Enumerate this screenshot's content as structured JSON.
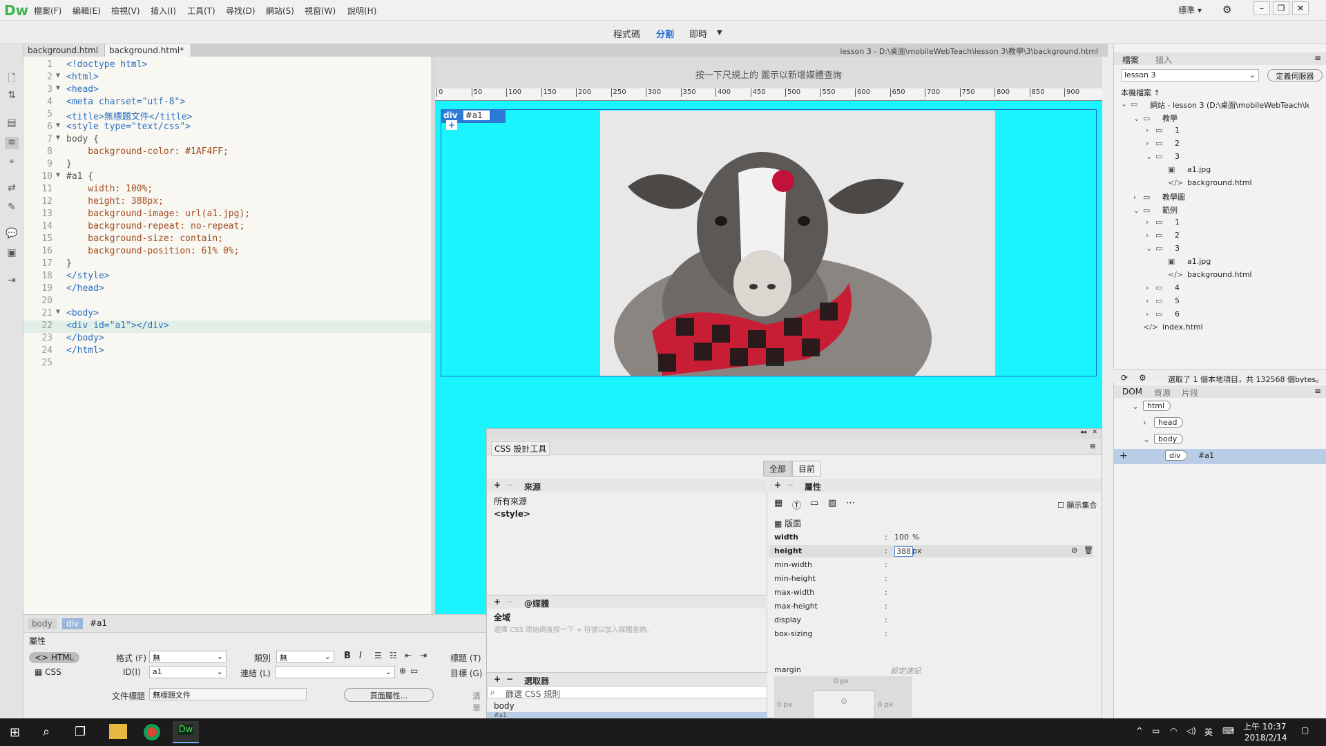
{
  "app": {
    "logo": "Dw"
  },
  "menu": [
    "檔案(F)",
    "編輯(E)",
    "檢視(V)",
    "插入(I)",
    "工具(T)",
    "尋找(D)",
    "網站(S)",
    "視窗(W)",
    "說明(H)"
  ],
  "layout_label": "標準",
  "view_buttons": {
    "code": "程式碼",
    "split": "分割",
    "live": "即時"
  },
  "tabs": [
    "background.html",
    "background.html*"
  ],
  "doc_path": "lesson 3 - D:\\桌面\\mobileWebTeach\\lesson 3\\教學\\3\\background.html",
  "code_lines": [
    {
      "n": "1",
      "text": "<!doctype html>"
    },
    {
      "n": "2",
      "text": "<html>"
    },
    {
      "n": "3",
      "text": "<head>"
    },
    {
      "n": "4",
      "text": "<meta charset=\"utf-8\">"
    },
    {
      "n": "5",
      "text": "<title>無標題文件</title>"
    },
    {
      "n": "6",
      "text": "<style type=\"text/css\">"
    },
    {
      "n": "7",
      "text": "body {"
    },
    {
      "n": "8",
      "text": "    background-color: #1AF4FF;"
    },
    {
      "n": "9",
      "text": "}"
    },
    {
      "n": "10",
      "text": "#a1 {"
    },
    {
      "n": "11",
      "text": "    width: 100%;"
    },
    {
      "n": "12",
      "text": "    height: 388px;"
    },
    {
      "n": "13",
      "text": "    background-image: url(a1.jpg);"
    },
    {
      "n": "14",
      "text": "    background-repeat: no-repeat;"
    },
    {
      "n": "15",
      "text": "    background-size: contain;"
    },
    {
      "n": "16",
      "text": "    background-position: 61% 0%;"
    },
    {
      "n": "17",
      "text": "}"
    },
    {
      "n": "18",
      "text": "</style>"
    },
    {
      "n": "19",
      "text": "</head>"
    },
    {
      "n": "20",
      "text": ""
    },
    {
      "n": "21",
      "text": "<body>"
    },
    {
      "n": "22",
      "text": "<div id=\"a1\"></div>"
    },
    {
      "n": "23",
      "text": "</body>"
    },
    {
      "n": "24",
      "text": "</html>"
    },
    {
      "n": "25",
      "text": ""
    }
  ],
  "design": {
    "mq_hint": "按一下尺規上的  圖示以新增媒體查詢",
    "ruler_ticks": [
      "0",
      "50",
      "100",
      "150",
      "200",
      "250",
      "300",
      "350",
      "400",
      "450",
      "500",
      "550",
      "600",
      "650",
      "700",
      "750",
      "800",
      "850",
      "900"
    ],
    "div_badge": "div",
    "div_id": "#a1",
    "bg_color": "#1AF4FF"
  },
  "css_designer": {
    "title": "CSS 設計工具",
    "modes": [
      "全部",
      "目前"
    ],
    "sources_label": "來源",
    "sources": [
      "所有來源",
      "<style>"
    ],
    "media_label": "@媒體",
    "media_global": "全域",
    "media_hint": "選擇 CSS 原始碼後按一下 + 符號以加入媒體查詢。",
    "selectors_label": "選取器",
    "filter_placeholder": "篩選 CSS 規則",
    "selectors": [
      "body",
      "#a1"
    ],
    "properties_label": "屬性",
    "show_set": "顯示集合",
    "layout_section": "版面",
    "props": [
      {
        "name": "width",
        "value": "100",
        "unit": "%"
      },
      {
        "name": "height",
        "value": "388",
        "unit": "px"
      },
      {
        "name": "min-width",
        "value": "",
        "unit": ""
      },
      {
        "name": "min-height",
        "value": "",
        "unit": ""
      },
      {
        "name": "max-width",
        "value": "",
        "unit": ""
      },
      {
        "name": "max-height",
        "value": "",
        "unit": ""
      },
      {
        "name": "display",
        "value": "",
        "unit": ""
      },
      {
        "name": "box-sizing",
        "value": "",
        "unit": ""
      }
    ],
    "margin_label": "margin",
    "margin_hint": "設定速記",
    "margin_values": [
      "0 px",
      "0 px",
      "0 px",
      "0 px"
    ]
  },
  "tag_selector": [
    "body",
    "div",
    "#a1"
  ],
  "properties_panel": {
    "title": "屬性",
    "html_btn": "HTML",
    "css_btn": "CSS",
    "format_label": "格式 (F)",
    "format_value": "無",
    "id_label": "ID(I)",
    "id_value": "a1",
    "class_label": "類別",
    "class_value": "無",
    "link_label": "連結 (L)",
    "title_label": "標題 (T)",
    "target_label": "目標 (G)",
    "doc_title_label": "文件標題",
    "doc_title_value": "無標題文件",
    "page_props_btn": "頁面屬性...",
    "list_items_label": "清單"
  },
  "files_panel": {
    "tabs": [
      "檔案",
      "插入"
    ],
    "site_select": "lesson 3",
    "define_btn": "定義伺服器",
    "local_files": "本機檔案 ↑",
    "tree": [
      {
        "d": 0,
        "t": "網站 - lesson 3 (D:\\桌面\\mobileWebTeach\\less...",
        "k": "folder"
      },
      {
        "d": 1,
        "t": "教學",
        "k": "folder"
      },
      {
        "d": 2,
        "t": "1",
        "k": "folder"
      },
      {
        "d": 2,
        "t": "2",
        "k": "folder"
      },
      {
        "d": 2,
        "t": "3",
        "k": "folder"
      },
      {
        "d": 3,
        "t": "a1.jpg",
        "k": "image"
      },
      {
        "d": 3,
        "t": "background.html",
        "k": "code"
      },
      {
        "d": 1,
        "t": "教學圖",
        "k": "folder"
      },
      {
        "d": 1,
        "t": "範例",
        "k": "folder"
      },
      {
        "d": 2,
        "t": "1",
        "k": "folder"
      },
      {
        "d": 2,
        "t": "2",
        "k": "folder"
      },
      {
        "d": 2,
        "t": "3",
        "k": "folder"
      },
      {
        "d": 3,
        "t": "a1.jpg",
        "k": "image"
      },
      {
        "d": 3,
        "t": "background.html",
        "k": "code"
      },
      {
        "d": 2,
        "t": "4",
        "k": "folder"
      },
      {
        "d": 2,
        "t": "5",
        "k": "folder"
      },
      {
        "d": 2,
        "t": "6",
        "k": "folder"
      },
      {
        "d": 1,
        "t": "index.html",
        "k": "code"
      }
    ],
    "status": "選取了 1 個本地項目，共 132568 個bytes。"
  },
  "dom_panel": {
    "tabs": [
      "DOM",
      "資源",
      "片段"
    ],
    "nodes": [
      {
        "d": 0,
        "t": "html"
      },
      {
        "d": 1,
        "t": "head"
      },
      {
        "d": 1,
        "t": "body"
      },
      {
        "d": 2,
        "t": "div",
        "id": "#a1"
      }
    ]
  },
  "taskbar": {
    "time": "上午 10:37",
    "date": "2018/2/14",
    "ime": "英"
  }
}
